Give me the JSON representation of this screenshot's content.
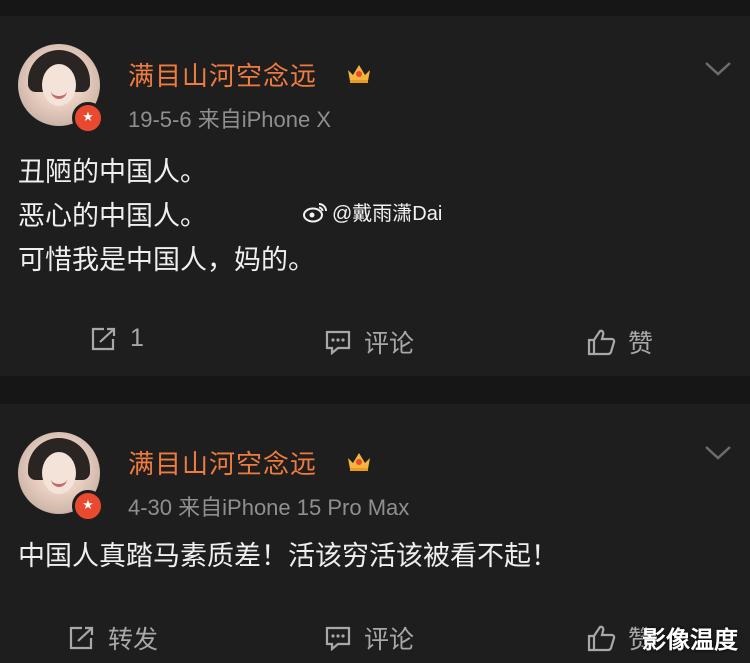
{
  "posts": [
    {
      "username": "满目山河空念远",
      "meta": "19-5-6  来自iPhone X",
      "lines": [
        "丑陋的中国人。",
        "恶心的中国人。",
        "可惜我是中国人，妈的。"
      ],
      "actions": {
        "repost": "1",
        "comment": "评论",
        "like": "赞"
      }
    },
    {
      "username": "满目山河空念远",
      "meta": "4-30  来自iPhone 15 Pro Max",
      "lines": [
        "中国人真踏马素质差！活该穷活该被看不起！"
      ],
      "actions": {
        "repost": "转发",
        "comment": "评论",
        "like": "赞"
      }
    }
  ],
  "watermark": "@戴雨潇Dai",
  "corner_watermark": "影像温度",
  "icons": [
    "verified-badge-icon",
    "crown-icon",
    "chevron-down-icon",
    "repost-icon",
    "comment-icon",
    "like-icon",
    "weibo-logo-icon"
  ],
  "colors": {
    "background": "#161616",
    "card": "#1e1e1e",
    "username": "#ef7b3f",
    "meta": "#8f8f8f",
    "text": "#efefef",
    "badge": "#e8492f"
  }
}
